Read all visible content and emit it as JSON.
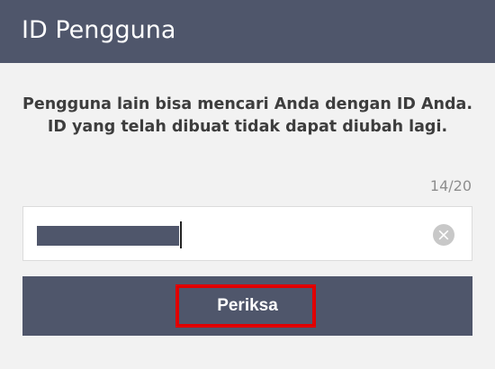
{
  "header": {
    "title": "ID Pengguna"
  },
  "description": {
    "line1": "Pengguna lain bisa mencari Anda dengan ID Anda.",
    "line2": "ID yang telah dibuat tidak dapat diubah lagi."
  },
  "id_field": {
    "char_counter": "14/20",
    "value_redacted": true,
    "clear_icon": "close-circle-icon"
  },
  "check_button": {
    "label": "Periksa",
    "highlight_color": "#e00000"
  },
  "colors": {
    "header_bg": "#4f566b",
    "button_bg": "#4f566b",
    "page_bg": "#f2f2f2"
  }
}
